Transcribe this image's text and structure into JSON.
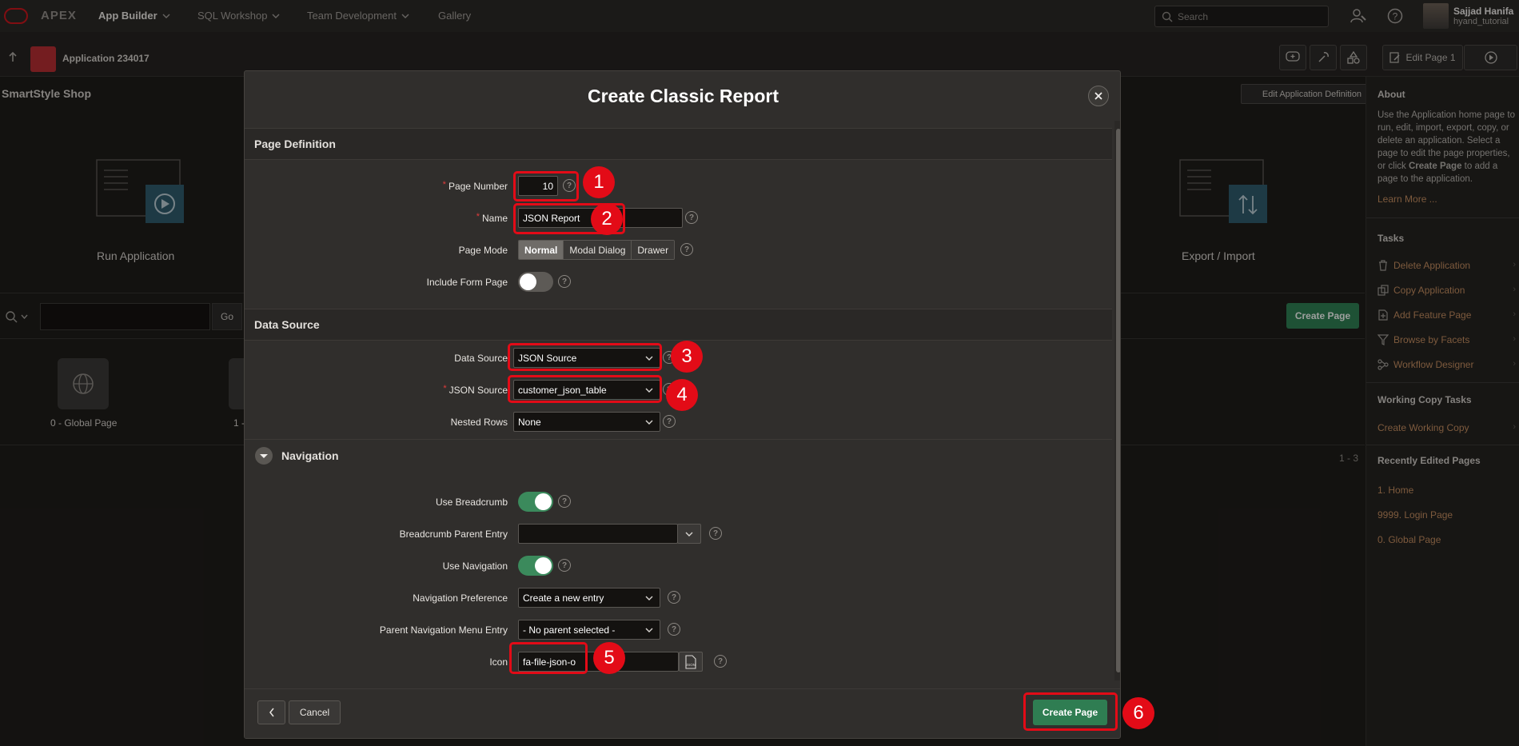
{
  "topbar": {
    "brand": "APEX",
    "nav": [
      "App Builder",
      "SQL Workshop",
      "Team Development",
      "Gallery"
    ],
    "search_placeholder": "Search",
    "user_name": "Sajjad Hanifa",
    "user_workspace": "hyand_tutorial"
  },
  "appbar": {
    "app_title": "Application 234017",
    "edit_page": "Edit Page 1"
  },
  "background": {
    "page_title": "SmartStyle Shop",
    "edit_app_def": "Edit Application Definition",
    "run_application": "Run Application",
    "export_import": "Export / Import",
    "go": "Go",
    "create_page": "Create Page",
    "global_page": "0 - Global Page",
    "page1_partial": "1 -",
    "range": "1 - 3"
  },
  "sidebar": {
    "about_h": "About",
    "about_text_1": "Use the Application home page to run, edit, import, export, copy, or delete an application. Select a page to edit the page properties, or click ",
    "about_text_bold": "Create Page",
    "about_text_2": " to add a page to the application.",
    "learn_more": "Learn More ...",
    "tasks_h": "Tasks",
    "tasks": [
      "Delete Application",
      "Copy Application",
      "Add Feature Page",
      "Browse by Facets",
      "Workflow Designer"
    ],
    "working_h": "Working Copy Tasks",
    "working_link": "Create Working Copy",
    "recent_h": "Recently Edited Pages",
    "recent": [
      "1. Home",
      "9999. Login Page",
      "0. Global Page"
    ]
  },
  "dialog": {
    "title": "Create Classic Report",
    "sections": {
      "page_definition": "Page Definition",
      "data_source": "Data Source",
      "navigation": "Navigation"
    },
    "labels": {
      "page_number": "Page Number",
      "name": "Name",
      "page_mode": "Page Mode",
      "include_form": "Include Form Page",
      "data_source": "Data Source",
      "json_source": "JSON Source",
      "nested_rows": "Nested Rows",
      "use_breadcrumb": "Use Breadcrumb",
      "breadcrumb_parent": "Breadcrumb Parent Entry",
      "use_navigation": "Use Navigation",
      "nav_pref": "Navigation Preference",
      "parent_nav": "Parent Navigation Menu Entry",
      "icon": "Icon"
    },
    "values": {
      "page_number": "10",
      "name": "JSON Report",
      "page_modes": [
        "Normal",
        "Modal Dialog",
        "Drawer"
      ],
      "page_mode_selected": "Normal",
      "include_form": false,
      "data_source": "JSON Source",
      "json_source": "customer_json_table",
      "nested_rows": "None",
      "use_breadcrumb": true,
      "breadcrumb_parent": "",
      "use_navigation": true,
      "nav_pref": "Create a new entry",
      "parent_nav": "- No parent selected -",
      "icon": "fa-file-json-o",
      "icon_preview": "JSON"
    },
    "help": "?",
    "cancel": "Cancel",
    "create_page": "Create Page"
  },
  "annotations": [
    "1",
    "2",
    "3",
    "4",
    "5",
    "6"
  ],
  "colors": {
    "highlight": "#e30b17",
    "primary_button": "#2f7d52",
    "toggle_on": "#3b8a5c",
    "link": "#c08a5e"
  }
}
